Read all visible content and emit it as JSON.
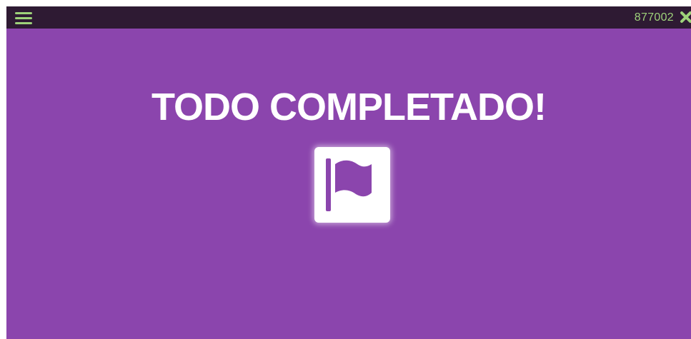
{
  "topbar": {
    "menu_icon": "hamburger-menu-icon",
    "score": "877002",
    "close_icon": "close-x-icon"
  },
  "main": {
    "headline": "TODO COMPLETADO!",
    "badge_icon": "flag-icon"
  },
  "colors": {
    "background": "#8b45ad",
    "topbar": "#2e1a33",
    "accent": "#9ed27a",
    "text": "#ffffff"
  }
}
